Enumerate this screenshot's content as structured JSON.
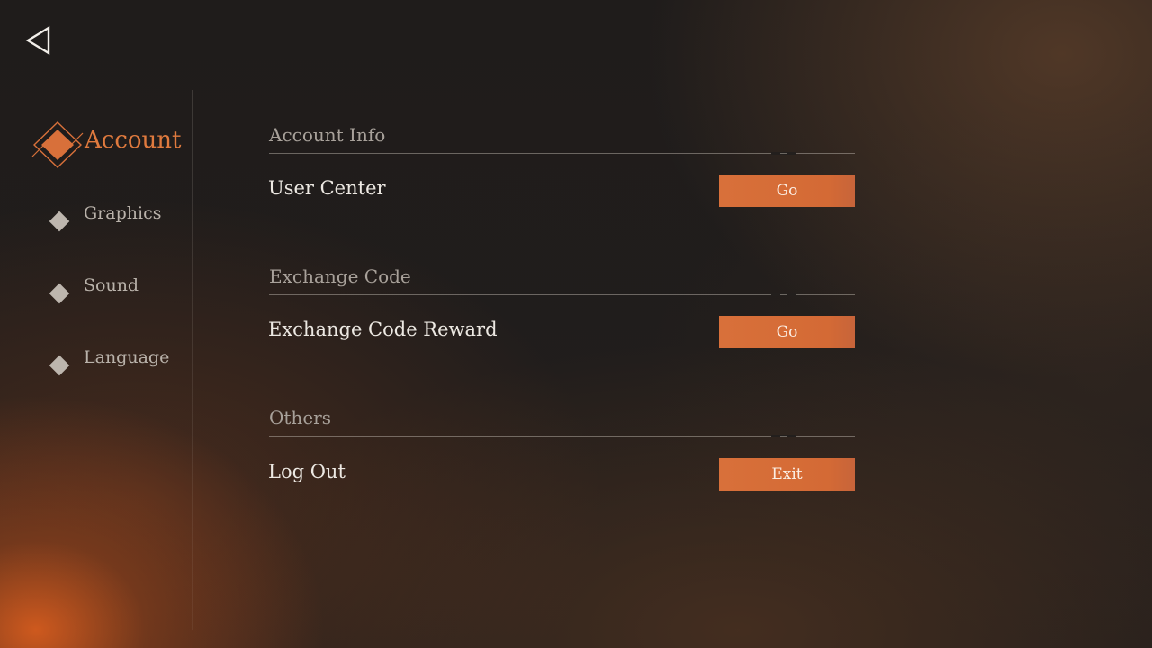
{
  "navigation": {
    "back_icon": "back-triangle-icon"
  },
  "sidebar": {
    "items": [
      {
        "id": "account",
        "label": "Account",
        "active": true,
        "icon": "ornate-diamond-icon"
      },
      {
        "id": "graphics",
        "label": "Graphics",
        "active": false,
        "icon": "diamond-bullet-icon"
      },
      {
        "id": "sound",
        "label": "Sound",
        "active": false,
        "icon": "diamond-bullet-icon"
      },
      {
        "id": "language",
        "label": "Language",
        "active": false,
        "icon": "diamond-bullet-icon"
      }
    ]
  },
  "sections": [
    {
      "title": "Account Info",
      "rows": [
        {
          "label": "User Center",
          "button": "Go"
        }
      ]
    },
    {
      "title": "Exchange Code",
      "rows": [
        {
          "label": "Exchange Code Reward",
          "button": "Go"
        }
      ]
    },
    {
      "title": "Others",
      "rows": [
        {
          "label": "Log Out",
          "button": "Exit"
        }
      ]
    }
  ],
  "colors": {
    "accent": "#d8703a",
    "active_text": "#e07a3e",
    "inactive_text": "#b9b2aa",
    "background": "#211e1c"
  }
}
